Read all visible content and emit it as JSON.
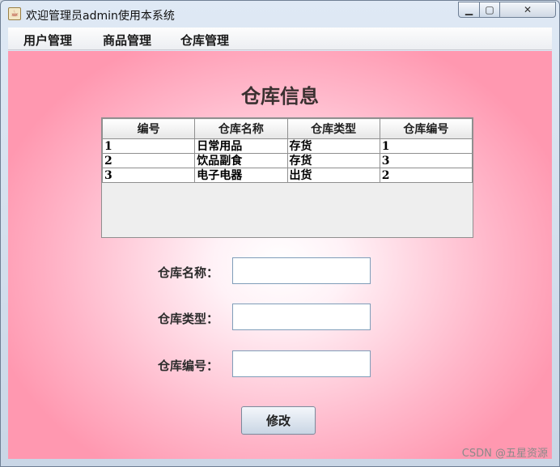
{
  "window": {
    "title": "欢迎管理员admin使用本系统",
    "app_icon_glyph": "☕"
  },
  "controls": {
    "min_glyph": "▁",
    "max_glyph": "▢",
    "close_glyph": "✕"
  },
  "menu": {
    "items": [
      "用户管理",
      "商品管理",
      "仓库管理"
    ]
  },
  "page": {
    "heading": "仓库信息"
  },
  "table": {
    "columns": [
      "编号",
      "仓库名称",
      "仓库类型",
      "仓库编号"
    ],
    "rows": [
      [
        "1",
        "日常用品",
        "存货",
        "1"
      ],
      [
        "2",
        "饮品副食",
        "存货",
        "3"
      ],
      [
        "3",
        "电子电器",
        "出货",
        "2"
      ]
    ]
  },
  "form": {
    "name_label": "仓库名称：",
    "type_label": "仓库类型：",
    "number_label": "仓库编号：",
    "name_value": "",
    "type_value": "",
    "number_value": ""
  },
  "actions": {
    "modify_label": "修改"
  },
  "watermark": "CSDN @五星资源"
}
